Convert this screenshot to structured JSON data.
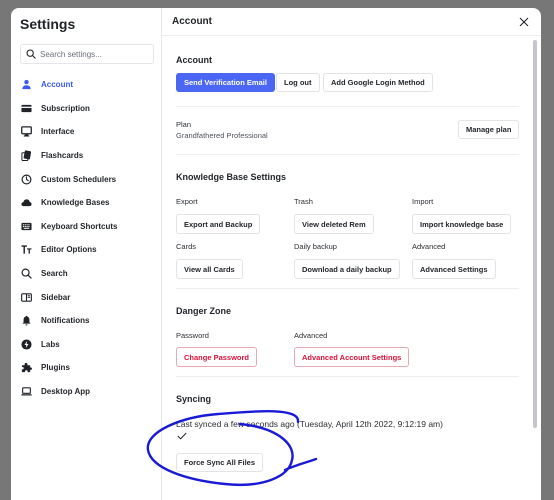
{
  "sidebar": {
    "title": "Settings",
    "search_placeholder": "Search settings...",
    "items": [
      {
        "label": "Account",
        "icon": "user-icon",
        "active": true
      },
      {
        "label": "Subscription",
        "icon": "credit-card-icon"
      },
      {
        "label": "Interface",
        "icon": "monitor-icon"
      },
      {
        "label": "Flashcards",
        "icon": "flashcards-icon"
      },
      {
        "label": "Custom Schedulers",
        "icon": "clock-icon"
      },
      {
        "label": "Knowledge Bases",
        "icon": "cloud-icon"
      },
      {
        "label": "Keyboard Shortcuts",
        "icon": "keyboard-icon"
      },
      {
        "label": "Editor Options",
        "icon": "text-size-icon"
      },
      {
        "label": "Search",
        "icon": "search-icon"
      },
      {
        "label": "Sidebar",
        "icon": "sidebar-icon"
      },
      {
        "label": "Notifications",
        "icon": "bell-icon"
      },
      {
        "label": "Labs",
        "icon": "lightning-icon"
      },
      {
        "label": "Plugins",
        "icon": "puzzle-icon"
      },
      {
        "label": "Desktop App",
        "icon": "laptop-icon"
      }
    ]
  },
  "main": {
    "title": "Account",
    "account": {
      "title": "Account",
      "send_verification": "Send Verification Email",
      "logout": "Log out",
      "add_google": "Add Google Login Method"
    },
    "plan": {
      "label": "Plan",
      "value": "Grandfathered Professional",
      "manage": "Manage plan"
    },
    "kb": {
      "title": "Knowledge Base Settings",
      "export_label": "Export",
      "export_btn": "Export and Backup",
      "trash_label": "Trash",
      "trash_btn": "View deleted Rem",
      "import_label": "Import",
      "import_btn": "Import knowledge base",
      "cards_label": "Cards",
      "cards_btn": "View all Cards",
      "daily_label": "Daily backup",
      "daily_btn": "Download a daily backup",
      "advanced_label": "Advanced",
      "advanced_btn": "Advanced Settings"
    },
    "danger": {
      "title": "Danger Zone",
      "password_label": "Password",
      "password_btn": "Change Password",
      "advanced_label": "Advanced",
      "advanced_btn": "Advanced Account Settings"
    },
    "syncing": {
      "title": "Syncing",
      "status": "Last synced a few seconds ago (Tuesday, April 12th 2022, 9:12:19 am)",
      "force_sync": "Force Sync All Files"
    }
  },
  "colors": {
    "accent": "#4a66f2",
    "active_nav": "#3b5bf0",
    "danger": "#d8133a",
    "annotation": "#1a1ad6"
  }
}
